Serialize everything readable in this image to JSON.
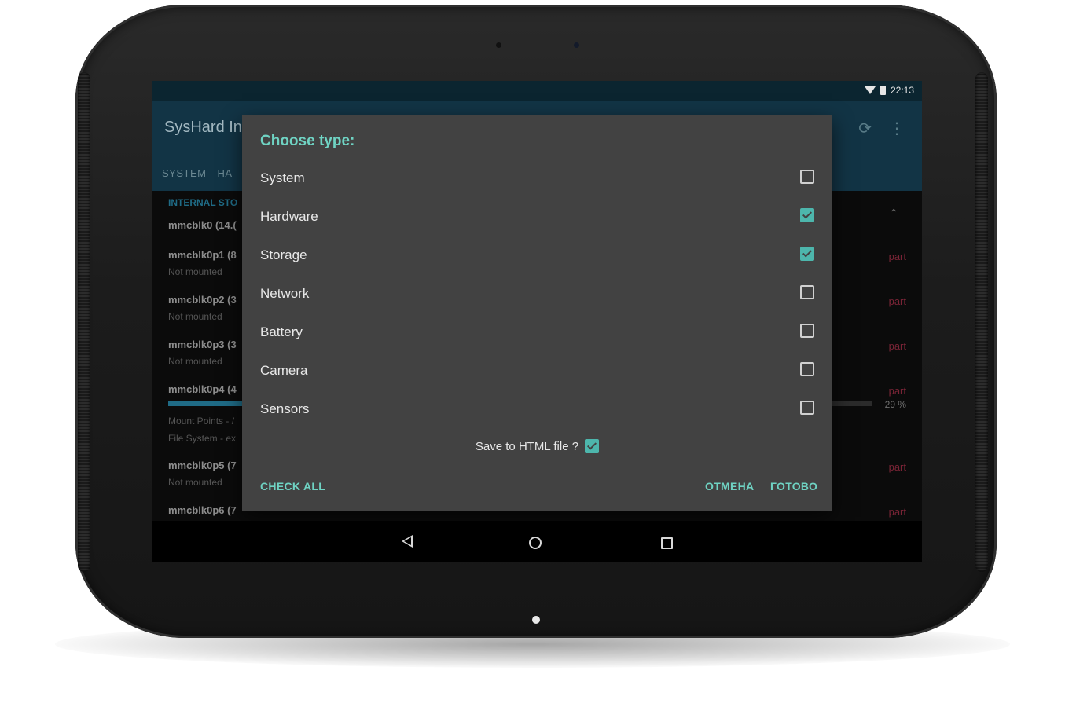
{
  "status_bar": {
    "time": "22:13"
  },
  "app": {
    "title": "SysHard In",
    "tabs": [
      "SYSTEM",
      "HA"
    ]
  },
  "background_list": {
    "section_title": "INTERNAL STO",
    "rows": [
      {
        "name": "mmcblk0 (14.(",
        "sub": ""
      },
      {
        "name": "mmcblk0p1 (8",
        "sub": "Not mounted",
        "tag": "part"
      },
      {
        "name": "mmcblk0p2 (3",
        "sub": "Not mounted",
        "tag": "part"
      },
      {
        "name": "mmcblk0p3 (3",
        "sub": "Not mounted",
        "tag": "part"
      },
      {
        "name": "mmcblk0p4 (4",
        "sub": "Mount Points - /",
        "sub2": "File System - ex",
        "tag": "part",
        "progress_percent_label": "29 %",
        "progress": 0.29
      },
      {
        "name": "mmcblk0p5 (7",
        "sub": "Not mounted",
        "tag": "part"
      },
      {
        "name": "mmcblk0p6 (7",
        "sub": "",
        "tag": "part"
      }
    ]
  },
  "dialog": {
    "title": "Choose type:",
    "options": [
      {
        "label": "System",
        "checked": false
      },
      {
        "label": "Hardware",
        "checked": true
      },
      {
        "label": "Storage",
        "checked": true
      },
      {
        "label": "Network",
        "checked": false
      },
      {
        "label": "Battery",
        "checked": false
      },
      {
        "label": "Camera",
        "checked": false
      },
      {
        "label": "Sensors",
        "checked": false
      }
    ],
    "save_label": "Save to HTML file ?",
    "save_checked": true,
    "check_all": "CHECK ALL",
    "cancel": "ОТМЕНА",
    "done": "ГОТОВО"
  },
  "colors": {
    "accent": "#6fd3c3",
    "checkbox_on": "#4db6ac",
    "dialog_bg": "#424242",
    "appbar": "#123445"
  }
}
